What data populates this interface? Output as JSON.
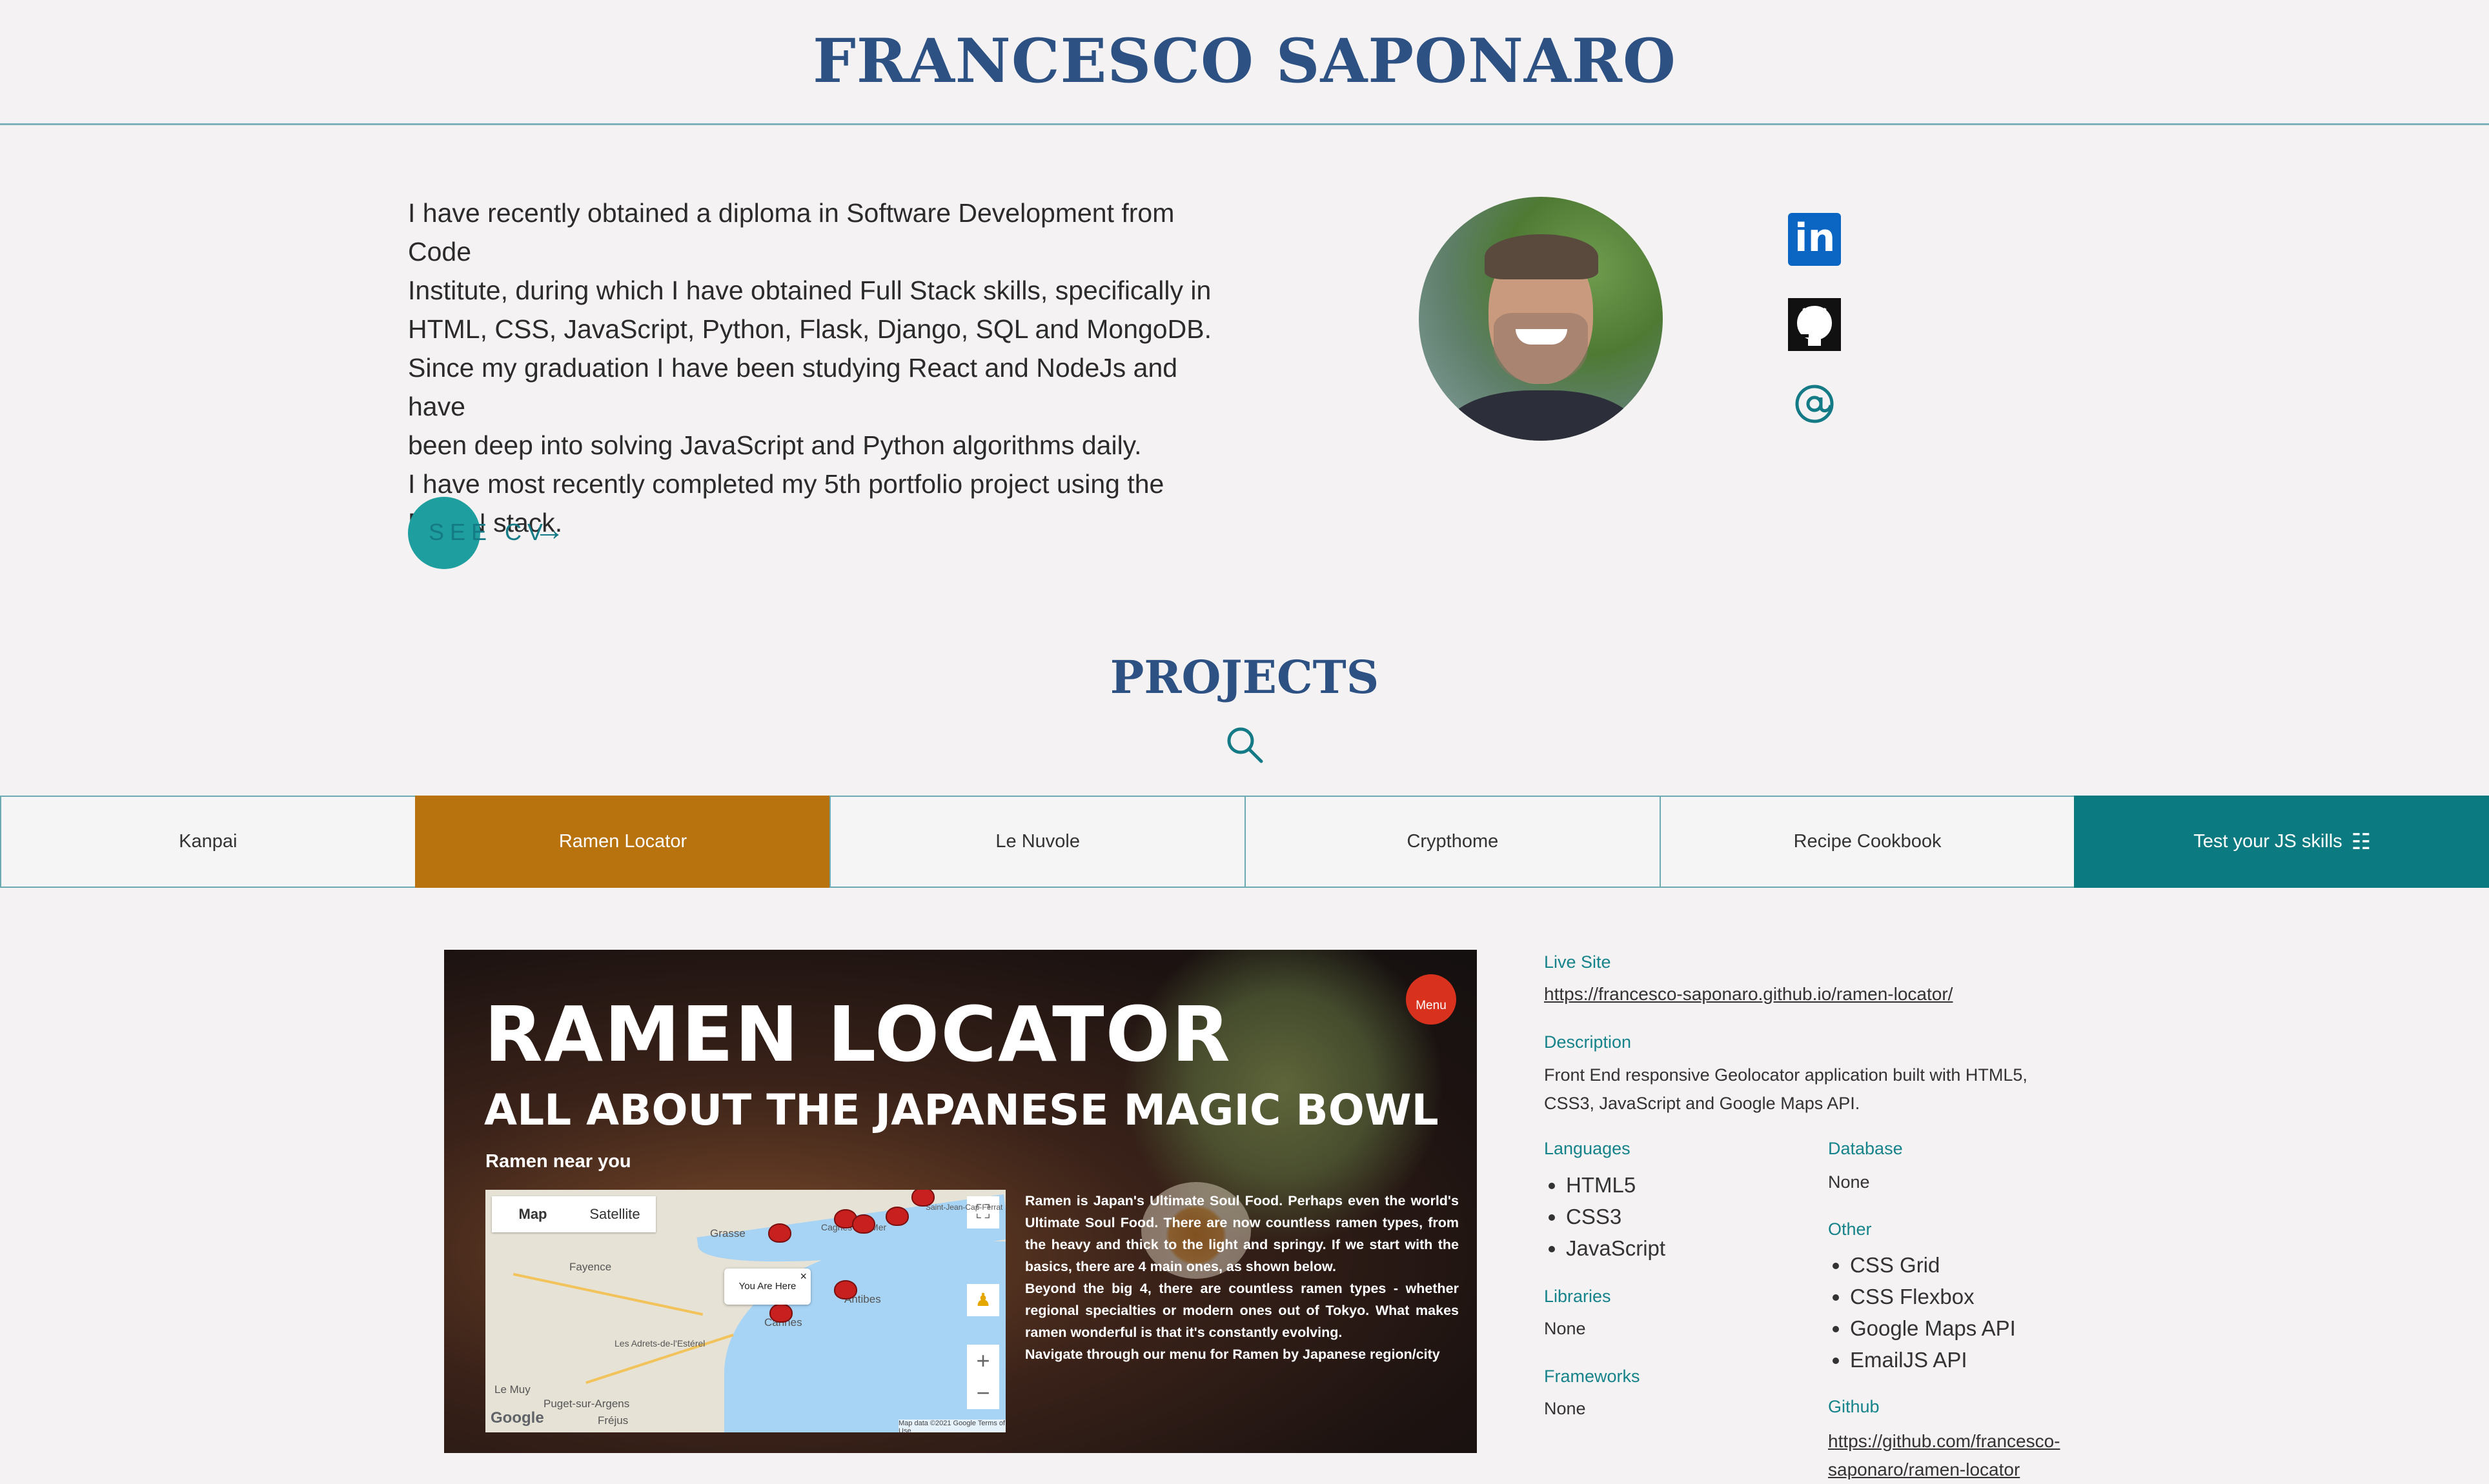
{
  "header": {
    "title": "FRANCESCO SAPONARO"
  },
  "about": {
    "line1": "I have recently obtained a diploma in Software Development from Code",
    "line2": "Institute, during which I have obtained Full Stack skills, specifically in",
    "line3": "HTML, CSS, JavaScript, Python, Flask, Django, SQL and MongoDB.",
    "line4": "Since my graduation I have been studying React and NodeJs and have",
    "line5": "been deep into solving JavaScript and Python algorithms daily.",
    "line6": "I have most recently completed my 5th portfolio project using the",
    "line7": "MERN stack.",
    "cv_label": "SEE CV",
    "cv_arrow": "→"
  },
  "social": {
    "linkedin": "in",
    "github": "github-icon",
    "email": "at-icon"
  },
  "projects": {
    "title": "PROJECTS",
    "tabs": [
      "Kanpai",
      "Ramen Locator",
      "Le Nuvole",
      "Crypthome",
      "Recipe Cookbook",
      "Test your JS skills"
    ],
    "active_tab": "Ramen Locator",
    "js_tab_icon": "☷"
  },
  "preview": {
    "title": "RAMEN LOCATOR",
    "subtitle": "ALL ABOUT THE JAPANESE MAGIC BOWL",
    "near": "Ramen near you",
    "menu": "Menu",
    "map": {
      "tab_map": "Map",
      "tab_satellite": "Satellite",
      "info": "You Are Here",
      "close": "×",
      "places": [
        "Grasse",
        "Cagnes-sur-Mer",
        "Saint-Jean-Cap-Ferrat",
        "Fayence",
        "Cannes",
        "Antibes",
        "Les Adrets-de-l'Estérel",
        "Le Muy",
        "Puget-sur-Argens",
        "Fréjus"
      ],
      "google": "Google",
      "credits": "Map data ©2021 Google   Terms of Use",
      "fullscreen": "⛶",
      "pegman": "♟",
      "zoom_in": "+",
      "zoom_out": "−"
    },
    "desc1": "Ramen is Japan's Ultimate Soul Food. Perhaps even the world's Ultimate Soul Food. There are now countless ramen types, from the heavy and thick to the light and springy. If we start with the basics, there are 4 main ones, as shown below.",
    "desc2": "Beyond the big 4, there are countless ramen types - whether regional specialties or modern ones out of Tokyo. What makes ramen wonderful is that it's constantly evolving.",
    "desc3": "Navigate through our menu for Ramen by Japanese region/city"
  },
  "details": {
    "live_label": "Live Site",
    "live_url": "https://francesco-saponaro.github.io/ramen-locator/",
    "desc_label": "Description",
    "desc_line1": "Front End responsive Geolocator application built with HTML5,",
    "desc_line2": "CSS3, JavaScript and Google Maps API.",
    "languages_label": "Languages",
    "languages": [
      "HTML5",
      "CSS3",
      "JavaScript"
    ],
    "libraries_label": "Libraries",
    "libraries": "None",
    "frameworks_label": "Frameworks",
    "frameworks": "None",
    "database_label": "Database",
    "database": "None",
    "other_label": "Other",
    "other": [
      "CSS Grid",
      "CSS Flexbox",
      "Google Maps API",
      "EmailJS API"
    ],
    "github_label": "Github",
    "github_line1": "https://github.com/francesco-",
    "github_line2": "saponaro/ramen-locator"
  },
  "colors": {
    "brand": "#2d5183",
    "accent": "#0c7b81",
    "active_tab": "#b8720e",
    "cv_circle": "#1e9e9e"
  }
}
